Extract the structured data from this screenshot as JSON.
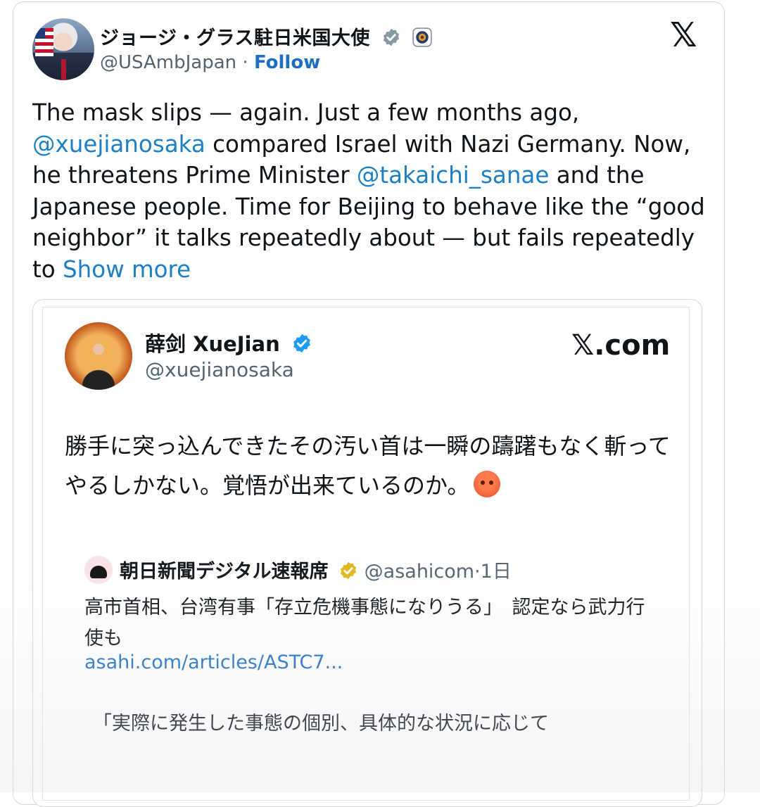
{
  "tweet": {
    "author_name": "ジョージ・グラス駐日米国大使",
    "author_handle": "@USAmbJapan",
    "separator": "·",
    "follow_label": "Follow",
    "platform_logo": "𝕏",
    "text_parts": {
      "p1": "The mask slips — again. Just a few months ago, ",
      "mention1": "@xuejianosaka",
      "p2": " compared Israel with Nazi Germany. Now, he threatens Prime Minister ",
      "mention2": "@takaichi_sanae",
      "p3": " and the Japanese people. Time for Beijing to behave like the “good neighbor” it talks repeatedly about — but fails repeatedly to ",
      "show_more": "Show more"
    }
  },
  "quoted_tweet": {
    "author_name": "薛剑 XueJian",
    "author_handle": "@xuejianosaka",
    "source_label": "𝕏.com",
    "text": "勝手に突っ込んできたその汚い首は一瞬の躊躇もなく斬ってやるしかない。覚悟が出来ているのか。",
    "emoji": "angry-face-icon"
  },
  "nested_quote": {
    "author_name": "朝日新聞デジタル速報席",
    "author_handle": "@asahicom",
    "time": "·1日",
    "text": "高市首相、台湾有事「存立危機事態になりうる」　認定なら武力行使も",
    "link": "asahi.com/articles/ASTC7...",
    "excerpt": "「実際に発生した事態の個別、具体的な状況に応じて"
  },
  "colors": {
    "link": "#1d7fc4",
    "verified_blue": "#1d9bf0",
    "verified_gold": "#e2b719",
    "border": "#cfd9de"
  }
}
